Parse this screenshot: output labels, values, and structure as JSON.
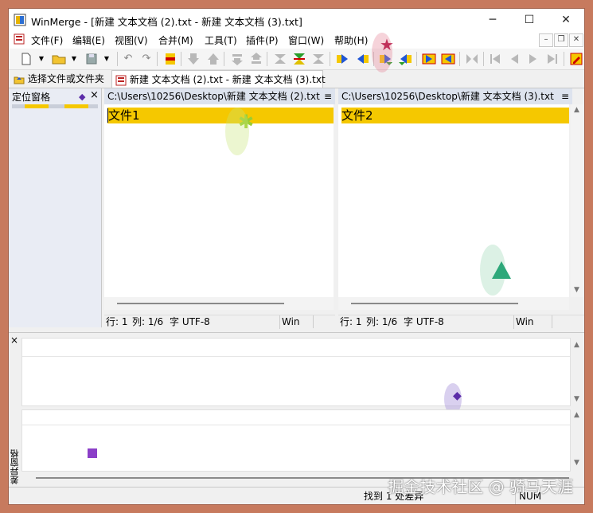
{
  "window": {
    "title": "WinMerge - [新建 文本文档 (2).txt - 新建 文本文档 (3).txt]",
    "minimize": "─",
    "maximize": "☐",
    "close": "✕"
  },
  "menu": {
    "items": [
      "文件(F)",
      "编辑(E)",
      "视图(V)",
      "合并(M)",
      "工具(T)",
      "插件(P)",
      "窗口(W)",
      "帮助(H)"
    ],
    "mdi_min": "–",
    "mdi_restore": "❐",
    "mdi_close": "✕"
  },
  "tabs": {
    "select": "选择文件或文件夹",
    "compare": "新建 文本文档 (2).txt - 新建 文本文档 (3).txt"
  },
  "location_pane": {
    "title": "定位窗格",
    "close": "×"
  },
  "left_pane": {
    "path": "C:\\Users\\10256\\Desktop\\新建 文本文档 (2).txt",
    "line_text": "文件",
    "line_suffix": "1",
    "status_pos": "行: 1",
    "status_col": "列: 1/6",
    "status_enc": "字 UTF-8",
    "status_eol": "Win"
  },
  "right_pane": {
    "path": "C:\\Users\\10256\\Desktop\\新建 文本文档 (3).txt",
    "line_text": "文件",
    "line_suffix": "2",
    "status_pos": "行: 1",
    "status_col": "列: 1/6",
    "status_enc": "字 UTF-8",
    "status_eol": "Win"
  },
  "pane_menu": "≡",
  "diff_pane": {
    "title": "差异窗格",
    "close": "×"
  },
  "status_bar": {
    "message": "找到 1 处差异",
    "num": "NUM"
  },
  "watermark": "掘金技术社区 @ 骑马天涯",
  "colors": {
    "diff_highlight": "#f5c800",
    "pane_header": "#dde3ee",
    "window_border": "#c77a5e"
  }
}
